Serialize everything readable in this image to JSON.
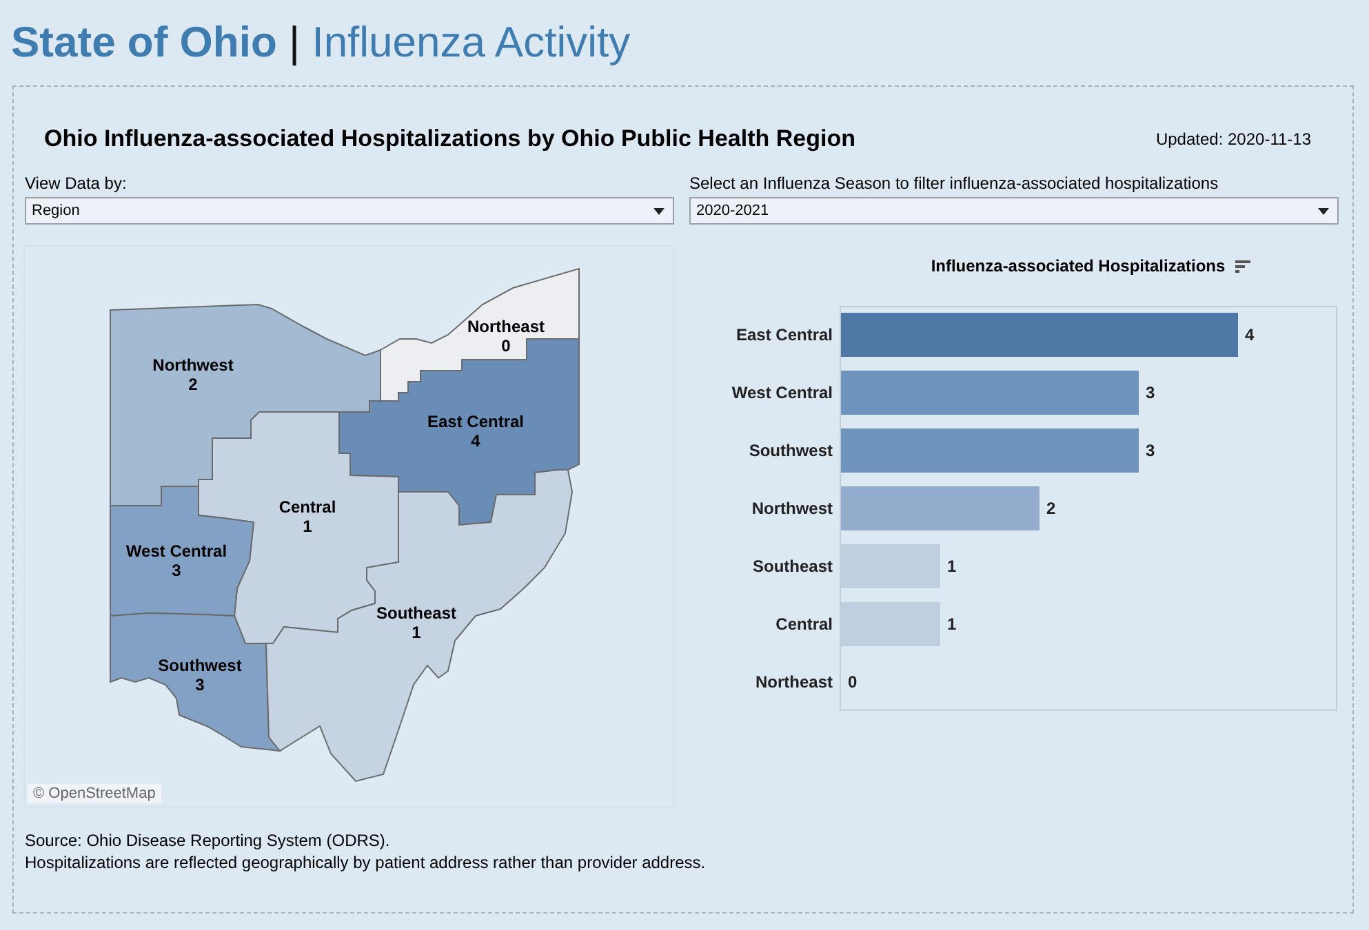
{
  "header": {
    "title_bold": "State of Ohio",
    "separator": "|",
    "title_light": "Influenza Activity"
  },
  "dashboard": {
    "title": "Ohio Influenza-associated Hospitalizations by Ohio Public Health Region",
    "updated": "Updated: 2020-11-13",
    "filters": [
      {
        "label": "View Data by:",
        "value": "Region"
      },
      {
        "label": "Select an Influenza Season to filter influenza-associated hospitalizations",
        "value": "2020-2021"
      }
    ],
    "map": {
      "attribution": "© OpenStreetMap",
      "regions": [
        {
          "name": "Northwest",
          "value": "2",
          "color": "#a3bad3"
        },
        {
          "name": "Northeast",
          "value": "0",
          "color": "#eceef1"
        },
        {
          "name": "East Central",
          "value": "4",
          "color": "#6a8db7"
        },
        {
          "name": "Central",
          "value": "1",
          "color": "#c5d3e2"
        },
        {
          "name": "West Central",
          "value": "3",
          "color": "#82a1c5"
        },
        {
          "name": "Southwest",
          "value": "3",
          "color": "#82a1c5"
        },
        {
          "name": "Southeast",
          "value": "1",
          "color": "#c5d3e2"
        }
      ]
    },
    "chart": {
      "chart_data": {
        "type": "bar",
        "orientation": "horizontal",
        "title": "Influenza-associated Hospitalizations",
        "categories": [
          "East Central",
          "West Central",
          "Southwest",
          "Northwest",
          "Southeast",
          "Central",
          "Northeast"
        ],
        "values": [
          4,
          3,
          3,
          2,
          1,
          1,
          0
        ],
        "data_labels": true
      }
    },
    "footnotes": [
      "Source: Ohio Disease Reporting System (ODRS).",
      "Hospitalizations are reflected geographically by patient address rather than provider address."
    ]
  }
}
